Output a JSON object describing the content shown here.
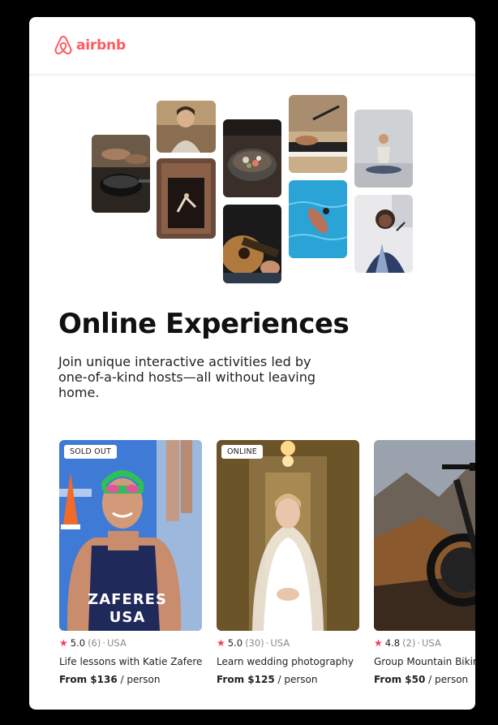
{
  "brand": {
    "name": "airbnb",
    "color": "#FF5A5F"
  },
  "hero": {
    "title": "Online Experiences",
    "subtitle": "Join unique interactive activities led by one-of-a-kind hosts—all without leaving home."
  },
  "listings": [
    {
      "badge": "SOLD OUT",
      "rating": "5.0",
      "reviews": "(6)",
      "country": "USA",
      "name": "Life lessons with Katie Zaferes",
      "price": "From $136",
      "per": "/ person",
      "jersey": "ZAFERES USA"
    },
    {
      "badge": "ONLINE",
      "rating": "5.0",
      "reviews": "(30)",
      "country": "USA",
      "name": "Learn wedding photography",
      "price": "From $125",
      "per": "/ person"
    },
    {
      "badge": "",
      "rating": "4.8",
      "reviews": "(2)",
      "country": "USA",
      "name": "Group Mountain Biking",
      "price": "From $50",
      "per": "/ person"
    }
  ],
  "icons": {
    "logo": "airbnb-belo-icon",
    "rating": "star-icon"
  },
  "colors": {
    "star": "#FF385C"
  }
}
